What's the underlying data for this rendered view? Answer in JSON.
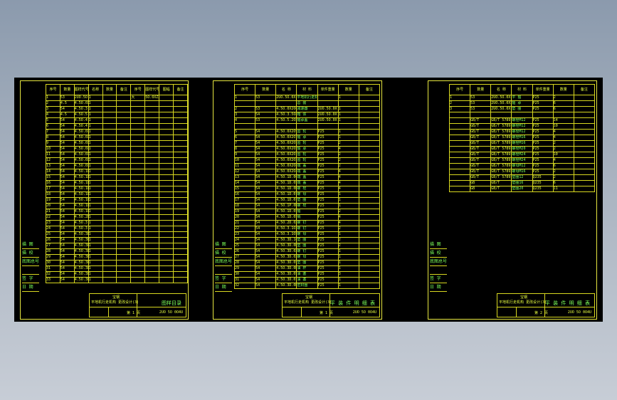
{
  "sheets": [
    {
      "headers": [
        "序号",
        "数量",
        "图样代号",
        "名称",
        "数量",
        "备注",
        "序号",
        "图样代号",
        "图幅",
        "备注"
      ],
      "rows": [
        [
          "1",
          "53",
          "2UO.5O.0X",
          "1",
          "",
          "",
          "大",
          "5O.0XZ25",
          "",
          ""
        ],
        [
          "2",
          "4.5",
          "4.5O.0X2OO",
          "1",
          "",
          "",
          "",
          "",
          "",
          ""
        ],
        [
          "3",
          "54",
          "4.5O.3.5O8",
          "1",
          "",
          "",
          "",
          "",
          "",
          ""
        ],
        [
          "4",
          "4.5",
          "4.5O.5.2O5",
          "1",
          "",
          "",
          "",
          "",
          "",
          ""
        ],
        [
          "5",
          "54",
          "4.5O.4.2O8",
          "1",
          "",
          "",
          "",
          "",
          "",
          ""
        ],
        [
          "6",
          "54",
          "4.5O.4.2O9",
          "1",
          "",
          "",
          "",
          "",
          "",
          ""
        ],
        [
          "7",
          "54",
          "4.5O.0X2O7",
          "1",
          "",
          "",
          "",
          "",
          "",
          ""
        ],
        [
          "8",
          "54",
          "4.5O.0X2OS",
          "1",
          "",
          "",
          "",
          "",
          "",
          ""
        ],
        [
          "9",
          "54",
          "4.5O.0X2O5",
          "1",
          "",
          "",
          "",
          "",
          "",
          ""
        ],
        [
          "10",
          "54",
          "4.5O.0X2O1",
          "1",
          "",
          "",
          "",
          "",
          "",
          ""
        ],
        [
          "11",
          "54",
          "4.5O.0X2O3",
          "1",
          "",
          "",
          "",
          "",
          "",
          ""
        ],
        [
          "12",
          "54",
          "4.5O.0X2O8",
          "1",
          "",
          "",
          "",
          "",
          "",
          ""
        ],
        [
          "13",
          "54",
          "4.5O.0X2O4",
          "1",
          "",
          "",
          "",
          "",
          "",
          ""
        ],
        [
          "14",
          "54",
          "4.5O.1D.0O",
          "1",
          "",
          "",
          "",
          "",
          "",
          ""
        ],
        [
          "15",
          "54",
          "4.5O.1D.0S",
          "1",
          "",
          "",
          "",
          "",
          "",
          ""
        ],
        [
          "16",
          "54",
          "4.5O.1D.0D",
          "1",
          "",
          "",
          "",
          "",
          "",
          ""
        ],
        [
          "17",
          "54",
          "4.5O.1D.0.2",
          "1",
          "",
          "",
          "",
          "",
          "",
          ""
        ],
        [
          "18",
          "54",
          "4.5O.1D.0.7",
          "1",
          "",
          "",
          "",
          "",
          "",
          ""
        ],
        [
          "19",
          "54",
          "4.5O.1P.0D.5",
          "1",
          "",
          "",
          "",
          "",
          "",
          ""
        ],
        [
          "20",
          "54",
          "4.5O.1D.05",
          "1",
          "",
          "",
          "",
          "",
          "",
          ""
        ],
        [
          "21",
          "54",
          "4.5O.1D.0S",
          "1",
          "",
          "",
          "",
          "",
          "",
          ""
        ],
        [
          "22",
          "54",
          "4.5O.2D.0X",
          "1",
          "",
          "",
          "",
          "",
          "",
          ""
        ],
        [
          "23",
          "54",
          "4.5O.3.1O3",
          "1",
          "",
          "",
          "",
          "",
          "",
          ""
        ],
        [
          "24",
          "54",
          "4.5O.3.1O5",
          "1",
          "",
          "",
          "",
          "",
          "",
          ""
        ],
        [
          "25",
          "54",
          "4.5O.3D.1O.5",
          "1",
          "",
          "",
          "",
          "",
          "",
          ""
        ],
        [
          "26",
          "54",
          "4.5O.3D.0D",
          "1",
          "",
          "",
          "",
          "",
          "",
          ""
        ],
        [
          "27",
          "54",
          "4.5O.3D.0X",
          "1",
          "",
          "",
          "",
          "",
          "",
          ""
        ],
        [
          "28",
          "54",
          "4.5O.3D.0X",
          "1",
          "",
          "",
          "",
          "",
          "",
          ""
        ],
        [
          "29",
          "54",
          "4.5O.3D.0S",
          "1",
          "",
          "",
          "",
          "",
          "",
          ""
        ],
        [
          "30",
          "54",
          "4.5O.3D.0D",
          "1",
          "",
          "",
          "",
          "",
          "",
          ""
        ],
        [
          "31",
          "54",
          "4.5O.3D.0S",
          "1",
          "",
          "",
          "",
          "",
          "",
          ""
        ],
        [
          "32",
          "54",
          "4.5O.3D.0.3",
          "1",
          "",
          "",
          "",
          "",
          "",
          ""
        ],
        [
          "33",
          "54",
          "4.5O.3D.0D",
          "1",
          "",
          "",
          "",
          "",
          "",
          ""
        ]
      ],
      "side_labels": [
        "描 图",
        "描 校",
        "底图总号",
        "",
        "签 字",
        "日 期"
      ],
      "tb_title": "图样目录",
      "tb_company": "宝钢",
      "tb_project": "平地机行走机构 更改设计(3)",
      "tb_code": "2UO 5O 0O4U",
      "tb_sheet": "第 1 页"
    },
    {
      "headers": [
        "序号",
        "数量",
        "名 称",
        "材 料",
        "单件重量",
        "数量",
        "备注"
      ],
      "rows": [
        [
          "1",
          "53",
          "2UO.5O.0X",
          "平地机行走机构",
          "",
          "1",
          ""
        ],
        [
          "",
          "",
          "",
          "总 装",
          "",
          "",
          ""
        ],
        [
          "2",
          "53",
          "4.5O.0X2OO",
          "减速器",
          "2UO.5O.0X",
          "1",
          ""
        ],
        [
          "3",
          "54",
          "4.5O.3.5O8",
          "箱 体",
          "2UO.5O.0X",
          "1",
          ""
        ],
        [
          "4",
          "53",
          "4.5O.5.2O5",
          "轴承盖",
          "2UO.5O.0X",
          "1",
          ""
        ],
        [
          "",
          "",
          "",
          "",
          "",
          "",
          ""
        ],
        [
          "5",
          "54",
          "4.5O.0X2O9",
          "齿 轮",
          "P25",
          "1",
          ""
        ],
        [
          "6",
          "54",
          "4.5O.0X2O7",
          "轴 承",
          "P25",
          "1",
          ""
        ],
        [
          "7",
          "54",
          "4.5O.0X2OS",
          "齿 轮",
          "P25",
          "2",
          ""
        ],
        [
          "8",
          "54",
          "4.5O.0X2O5",
          "轴 承",
          "P25",
          "4",
          ""
        ],
        [
          "9",
          "54",
          "4.5O.0X2O1",
          "齿 轮",
          "P25",
          "2",
          ""
        ],
        [
          "10",
          "54",
          "4.5O.0X2O3",
          "齿 轮",
          "P25",
          "2",
          ""
        ],
        [
          "11",
          "54",
          "4.5O.0X2O8",
          "端 盖",
          "P25",
          "2",
          ""
        ],
        [
          "12",
          "54",
          "4.5O.0X2O4",
          "端 盖",
          "P25",
          "4",
          ""
        ],
        [
          "13",
          "54",
          "4.5O.1D.0O",
          "端 盖",
          "P25",
          "4",
          ""
        ],
        [
          "14",
          "54",
          "4.5O.1D.0S",
          "端 盖",
          "P25",
          "4",
          ""
        ],
        [
          "15",
          "54",
          "4.5O.1D.0D",
          "螺 栓",
          "P25",
          "4",
          ""
        ],
        [
          "16",
          "54",
          "4.5O.1D.0.2",
          "螺 母",
          "P25",
          "1",
          ""
        ],
        [
          "17",
          "54",
          "4.5O.1D.0.7",
          "垫 圈",
          "P25",
          "1",
          ""
        ],
        [
          "18",
          "54",
          "4.5O.1P.0D.5",
          "螺 栓",
          "P25",
          "1",
          ""
        ],
        [
          "19",
          "54",
          "4.5O.1D.05",
          "轴",
          "P25",
          "2",
          ""
        ],
        [
          "20",
          "54",
          "4.5O.1D.0S",
          "销",
          "P25",
          "4",
          ""
        ],
        [
          "21",
          "54",
          "4.5O.2D.0X",
          "螺 钉",
          "P25",
          "4",
          ""
        ],
        [
          "22",
          "54",
          "4.5O.3.1O3",
          "螺 钉",
          "P25",
          "2",
          ""
        ],
        [
          "23",
          "54",
          "4.5O.3.1O5",
          "螺 母",
          "P25",
          "1",
          ""
        ],
        [
          "24",
          "54",
          "4.5O.3D.1O.5",
          "垫 圈",
          "P25",
          "2",
          ""
        ],
        [
          "25",
          "54",
          "4.5O.3D.0D",
          "垫 圈",
          "P25",
          "2",
          ""
        ],
        [
          "26",
          "54",
          "4.5O.3D.0X",
          "螺 钉",
          "P25",
          "1",
          ""
        ],
        [
          "27",
          "54",
          "4.5O.3D.0X",
          "螺 母",
          "P25",
          "1",
          ""
        ],
        [
          "28",
          "54",
          "4.5O.3D.0S",
          "垫 圈",
          "P25",
          "1",
          ""
        ],
        [
          "29",
          "54",
          "4.5O.3D.0D",
          "油 杯",
          "P25",
          "1",
          ""
        ],
        [
          "30",
          "54",
          "4.5O.3D.0S",
          "油 塞",
          "P25",
          "3",
          ""
        ],
        [
          "31",
          "54",
          "4.5O.3D.0.3",
          "油 塞",
          "P25",
          "1",
          ""
        ],
        [
          "32",
          "54",
          "4.5O.3D.0D",
          "密封圈",
          "P25",
          "1",
          ""
        ]
      ],
      "side_labels": [
        "描 图",
        "描 校",
        "底图总号",
        "",
        "签 字",
        "日 期"
      ],
      "tb_title": "平 装 件 明 细 表",
      "tb_company": "宝钢",
      "tb_project": "平地机行走机构 更改设计(3)",
      "tb_code": "2UO 5O 0O4U",
      "tb_sheet": "第 1 页"
    },
    {
      "headers": [
        "序号",
        "数量",
        "名 称",
        "材 料",
        "单件重量",
        "数量",
        "备注"
      ],
      "rows": [
        [
          "1",
          "53",
          "2UO.5O.0X.13",
          "平 轴",
          "P25",
          "2",
          ""
        ],
        [
          "2",
          "53",
          "2UO.5O.0X2O.5",
          "轴 承",
          "P25",
          "6",
          ""
        ],
        [
          "3",
          "53",
          "2UO.5O.0X.13",
          "垫 圈",
          "P25",
          "6",
          ""
        ],
        [
          "",
          "",
          "",
          "",
          "",
          "",
          ""
        ],
        [
          "",
          "GB/T",
          "GB/T 5789",
          "螺栓M12",
          "P25",
          "14",
          ""
        ],
        [
          "",
          "GB/T",
          "GB/T 5789",
          "螺栓M12",
          "P25",
          "10",
          ""
        ],
        [
          "",
          "GB/T",
          "GB/T 5789",
          "螺栓M12",
          "P25",
          "4",
          ""
        ],
        [
          "",
          "GB/T",
          "GB/T 5789",
          "螺栓M16",
          "P25",
          "4",
          ""
        ],
        [
          "",
          "GB/T",
          "GB/T 5789",
          "螺栓M16",
          "P25",
          "2",
          ""
        ],
        [
          "",
          "GB/T",
          "GB/T 5789",
          "螺栓M20",
          "P25",
          "2",
          ""
        ],
        [
          "",
          "GB/T",
          "GB/T 5789",
          "螺栓M24",
          "P25",
          "10",
          ""
        ],
        [
          "",
          "GB/T",
          "GB/T 5789",
          "螺栓M24",
          "P25",
          "4",
          ""
        ],
        [
          "",
          "GB/T",
          "GB/T 5789",
          "螺母M12",
          "P25",
          "6",
          ""
        ],
        [
          "",
          "GB/T",
          "GB/T 5789",
          "螺母M16",
          "P25",
          "2",
          ""
        ],
        [
          "",
          "GB/T",
          "GB/T 5789",
          "垫圈12",
          "Q235",
          "2",
          ""
        ],
        [
          "",
          "GB",
          "GB/T",
          "垫圈16",
          "Q235",
          "6",
          ""
        ],
        [
          "",
          "GB",
          "GB/T",
          "垫圈20",
          "Q235",
          "11",
          ""
        ]
      ],
      "side_labels": [
        "描 图",
        "描 校",
        "底图总号",
        "",
        "签 字",
        "日 期"
      ],
      "tb_title": "平 装 件 明 细 表",
      "tb_company": "宝钢",
      "tb_project": "平地机行走机构 更改设计(3)",
      "tb_code": "2UO 5O 0O4U",
      "tb_sheet": "第 2 页"
    }
  ]
}
